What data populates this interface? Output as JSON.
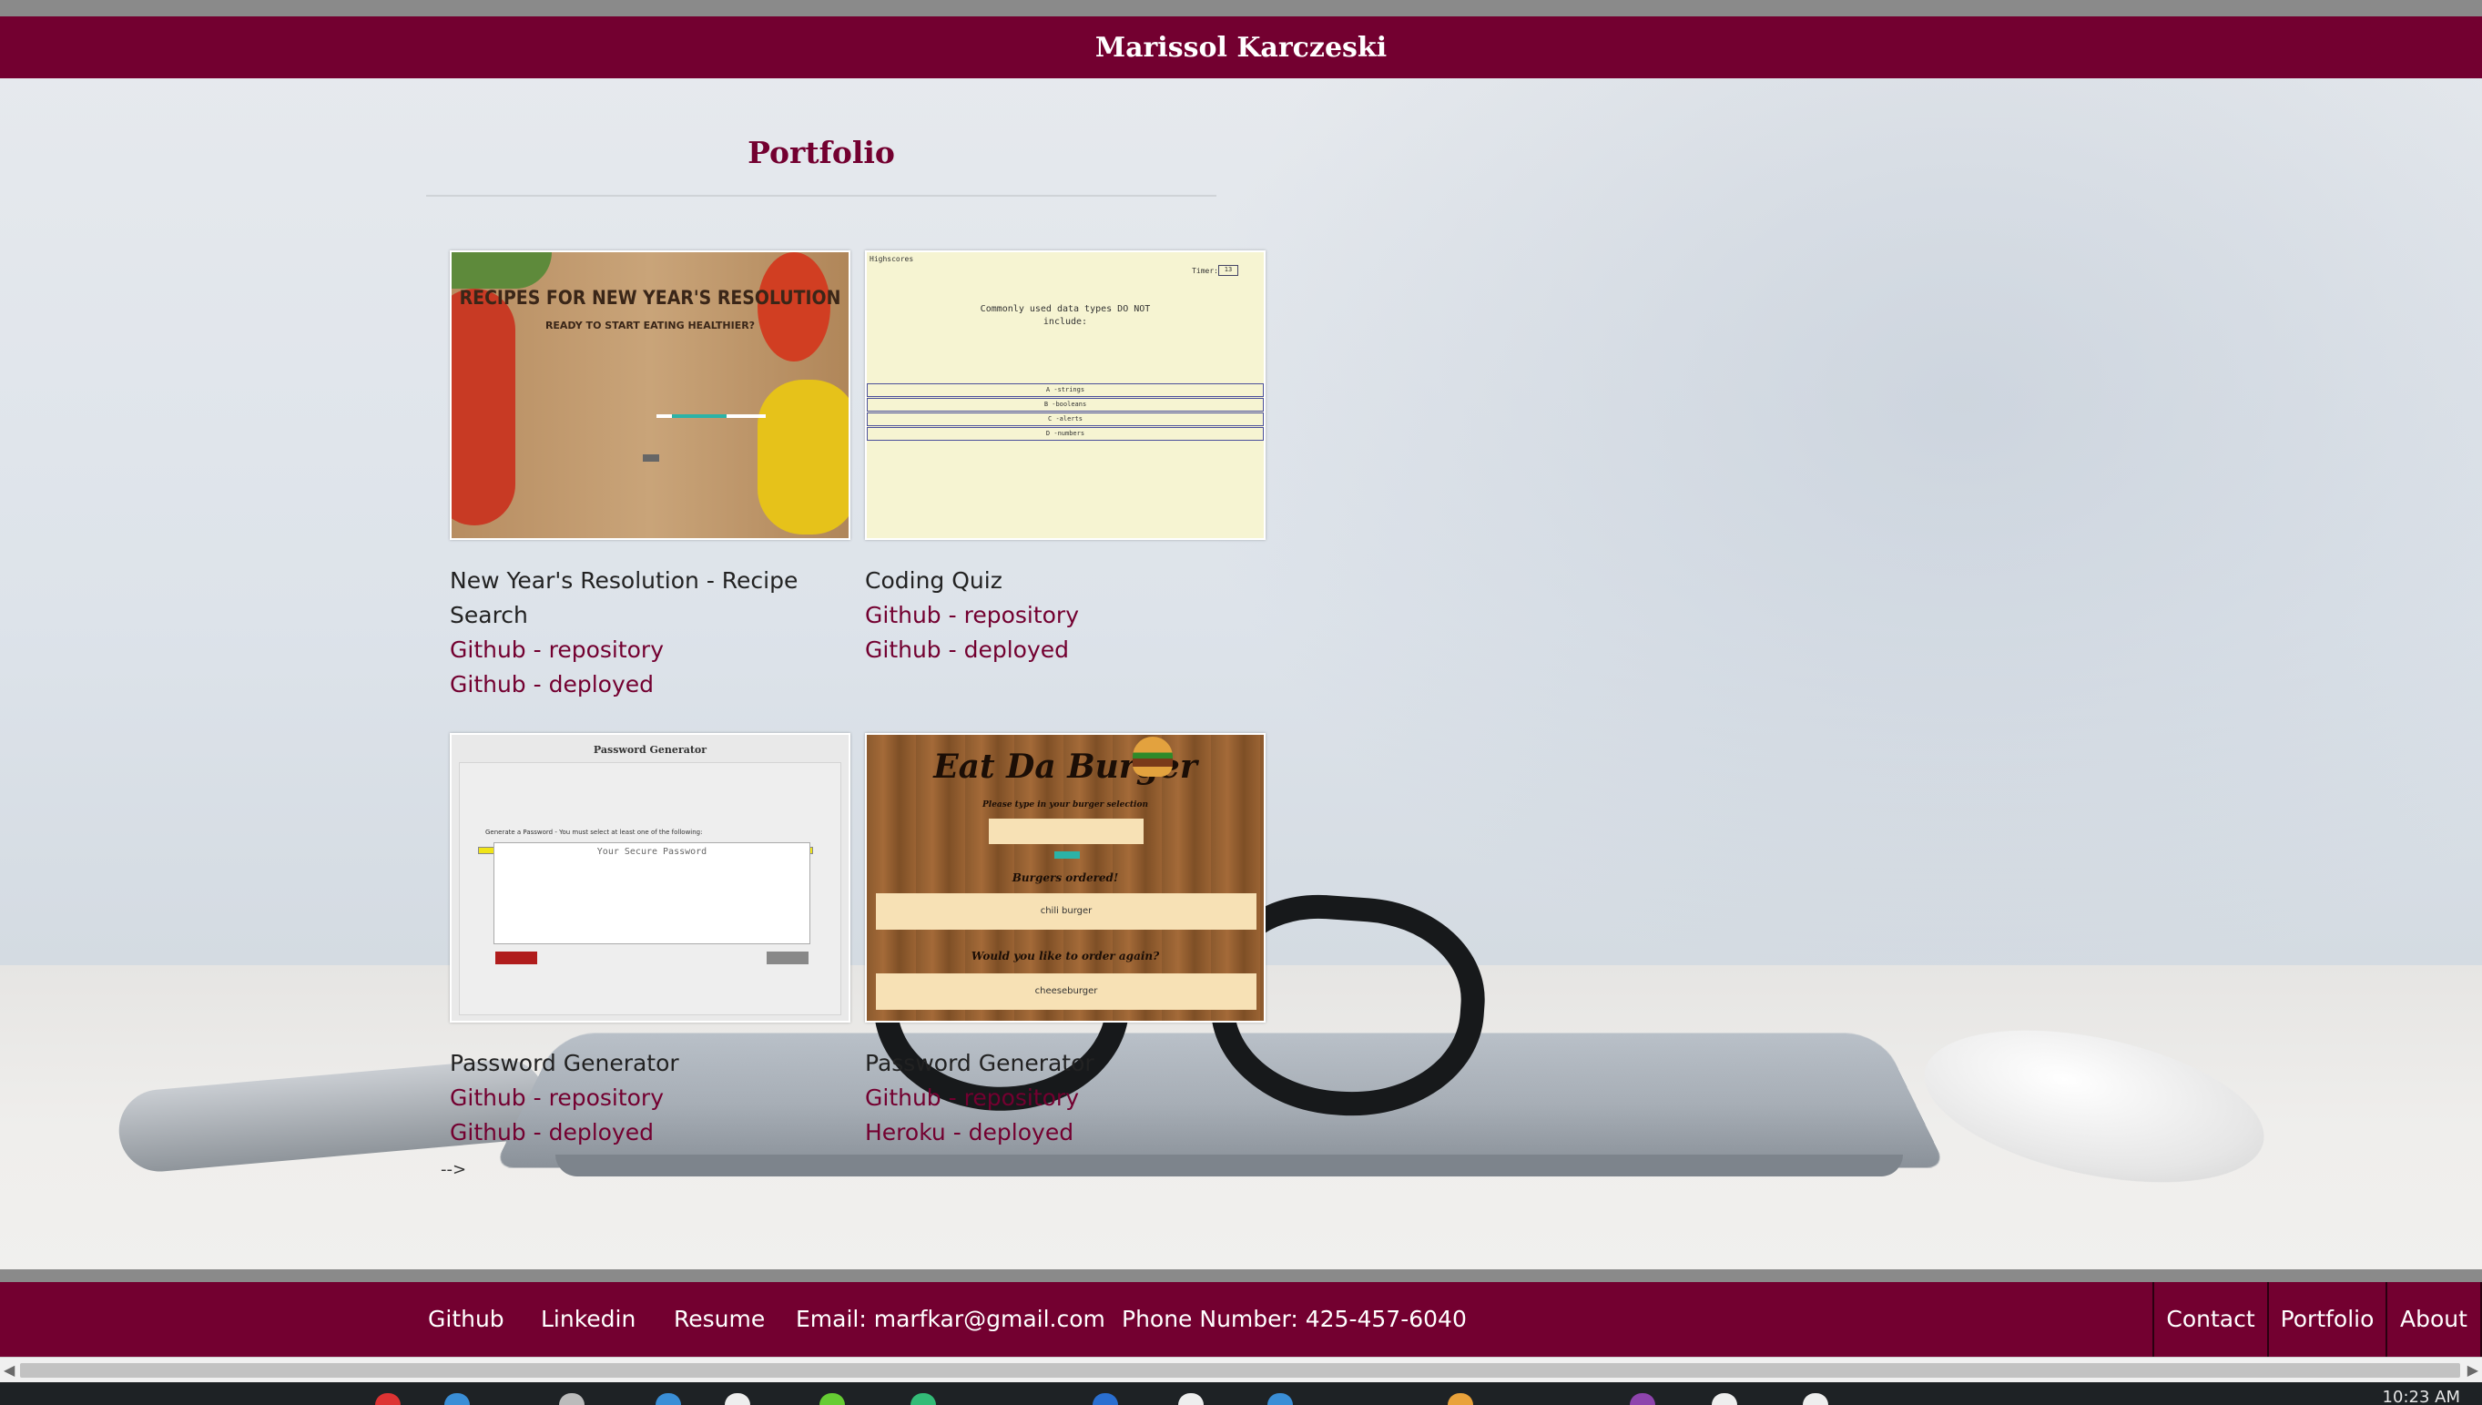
{
  "header": {
    "title": "Marissol Karczeski"
  },
  "portfolio": {
    "title": "Portfolio",
    "projects": [
      {
        "title": "New Year's Resolution - Recipe Search",
        "link1": "Github - repository",
        "link2": "Github - deployed",
        "thumb": {
          "heading": "RECIPES FOR NEW YEAR'S RESOLUTION",
          "subheading": "READY TO START EATING HEALTHIER?"
        }
      },
      {
        "title": "Coding Quiz",
        "link1": "Github - repository",
        "link2": "Github - deployed",
        "thumb": {
          "highscores": "Highscores",
          "timer_label": "Timer:",
          "timer_value": "13",
          "question": "Commonly used data types DO NOT include:",
          "options": [
            "A -strings",
            "B -booleans",
            "C -alerts",
            "D -numbers"
          ]
        }
      },
      {
        "title": "Password Generator",
        "link1": "Github - repository",
        "link2": "Github - deployed",
        "thumb": {
          "heading": "Password Generator",
          "label": "Generate a Password - You must select at least one of the following:",
          "placeholder": "Your Secure Password"
        }
      },
      {
        "title": "Password Generator",
        "link1": "Github - repository",
        "link2": "Heroku - deployed",
        "thumb": {
          "heading": "Eat Da Burger",
          "prompt": "Please type in your burger selection",
          "ordered_label": "Burgers ordered!",
          "ordered_item": "chili burger",
          "again_label": "Would you like to order again?",
          "again_item": "cheeseburger"
        }
      }
    ]
  },
  "stray_text": "-->",
  "footer": {
    "links": [
      "Github",
      "Linkedin",
      "Resume"
    ],
    "email": "Email: marfkar@gmail.com",
    "phone": "Phone Number: 425-457-6040",
    "nav": [
      "Contact",
      "Portfolio",
      "About"
    ]
  },
  "taskbar": {
    "clock": "10:23 AM"
  },
  "colors": {
    "brand": "#730030",
    "link": "#730030"
  },
  "icons": [
    "scroll-left-arrow-icon",
    "scroll-right-arrow-icon"
  ]
}
